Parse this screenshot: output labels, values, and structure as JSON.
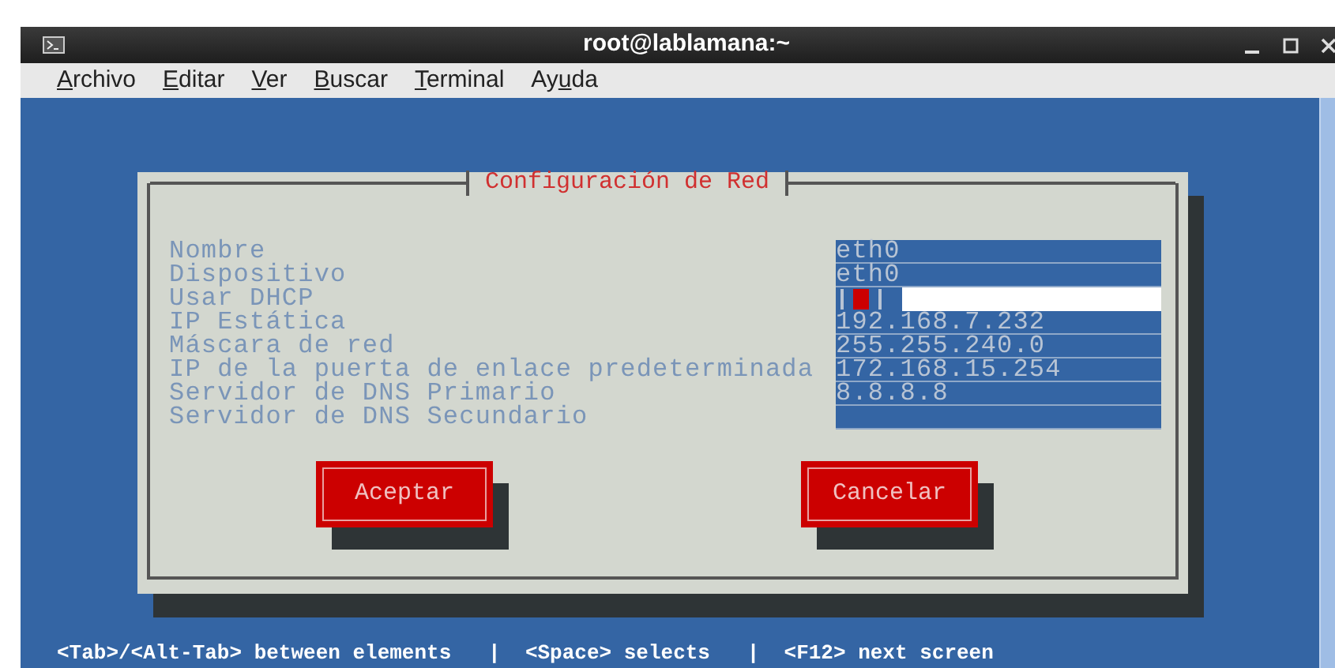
{
  "window": {
    "title": "root@lablamana:~"
  },
  "menu": [
    {
      "key": "A",
      "after": "rchivo"
    },
    {
      "key": "E",
      "after": "ditar"
    },
    {
      "key": "V",
      "after": "er"
    },
    {
      "key": "B",
      "after": "uscar"
    },
    {
      "key": "T",
      "after": "erminal"
    },
    {
      "before": "Ay",
      "key": "u",
      "after": "da"
    }
  ],
  "dialog": {
    "title": "Configuración de Red",
    "fields": [
      {
        "label": "Nombre",
        "kind": "text",
        "value": "eth0"
      },
      {
        "label": "Dispositivo",
        "kind": "text",
        "value": "eth0"
      },
      {
        "label": "Usar DHCP",
        "kind": "checkbox",
        "checked": false
      },
      {
        "label": "IP Estática",
        "kind": "text",
        "value": "192.168.7.232"
      },
      {
        "label": "Máscara de red",
        "kind": "text",
        "value": "255.255.240.0"
      },
      {
        "label": "IP de la puerta de enlace predeterminada",
        "kind": "text",
        "value": "172.168.15.254"
      },
      {
        "label": "Servidor de DNS Primario",
        "kind": "text",
        "value": "8.8.8.8"
      },
      {
        "label": "Servidor de DNS Secundario",
        "kind": "text"
      }
    ],
    "buttons": [
      "Aceptar",
      "Cancelar"
    ]
  },
  "status_bar": "<Tab>/<Alt-Tab> between elements   |  <Space> selects   |  <F12> next screen"
}
